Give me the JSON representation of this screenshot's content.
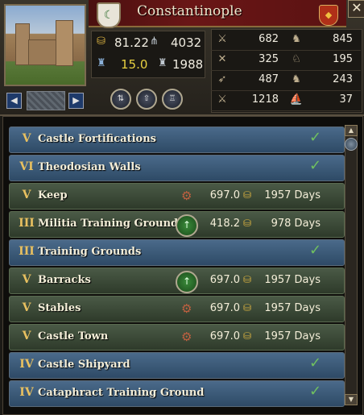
{
  "holding": {
    "name": "Constantinople",
    "close_label": "✕"
  },
  "stats": {
    "gold": "81.22",
    "levy": "4032",
    "tax": "15.0",
    "garrison": "1988"
  },
  "troops": [
    {
      "left_icon": "light-infantry-icon",
      "left_value": "682",
      "right_icon": "light-cavalry-icon",
      "right_value": "845"
    },
    {
      "left_icon": "heavy-infantry-icon",
      "left_value": "325",
      "right_icon": "heavy-cavalry-icon",
      "right_value": "195"
    },
    {
      "left_icon": "archer-icon",
      "left_value": "487",
      "right_icon": "horse-archer-icon",
      "right_value": "243"
    },
    {
      "left_icon": "pikemen-icon",
      "left_value": "1218",
      "right_icon": "galley-icon",
      "right_value": "37"
    }
  ],
  "buildings": [
    {
      "level": "V",
      "name": "Castle Fortifications",
      "state": "done"
    },
    {
      "level": "VI",
      "name": "Theodosian Walls",
      "state": "done"
    },
    {
      "level": "V",
      "name": "Keep",
      "state": "locked",
      "cost": "697.0",
      "days": "1957 Days"
    },
    {
      "level": "III",
      "name": "Militia Training Ground",
      "state": "upgradable",
      "cost": "418.2",
      "days": "978 Days"
    },
    {
      "level": "III",
      "name": "Training Grounds",
      "state": "done"
    },
    {
      "level": "V",
      "name": "Barracks",
      "state": "upgradable",
      "cost": "697.0",
      "days": "1957 Days"
    },
    {
      "level": "V",
      "name": "Stables",
      "state": "locked",
      "cost": "697.0",
      "days": "1957 Days"
    },
    {
      "level": "V",
      "name": "Castle Town",
      "state": "locked",
      "cost": "697.0",
      "days": "1957 Days"
    },
    {
      "level": "IV",
      "name": "Castle Shipyard",
      "state": "done"
    },
    {
      "level": "IV",
      "name": "Cataphract Training Ground",
      "state": "done"
    }
  ],
  "colors": {
    "accent": "#e8c060",
    "done_row": "#3a5a7a",
    "build_row": "#3a4a36",
    "title_bar": "#5a1212"
  }
}
